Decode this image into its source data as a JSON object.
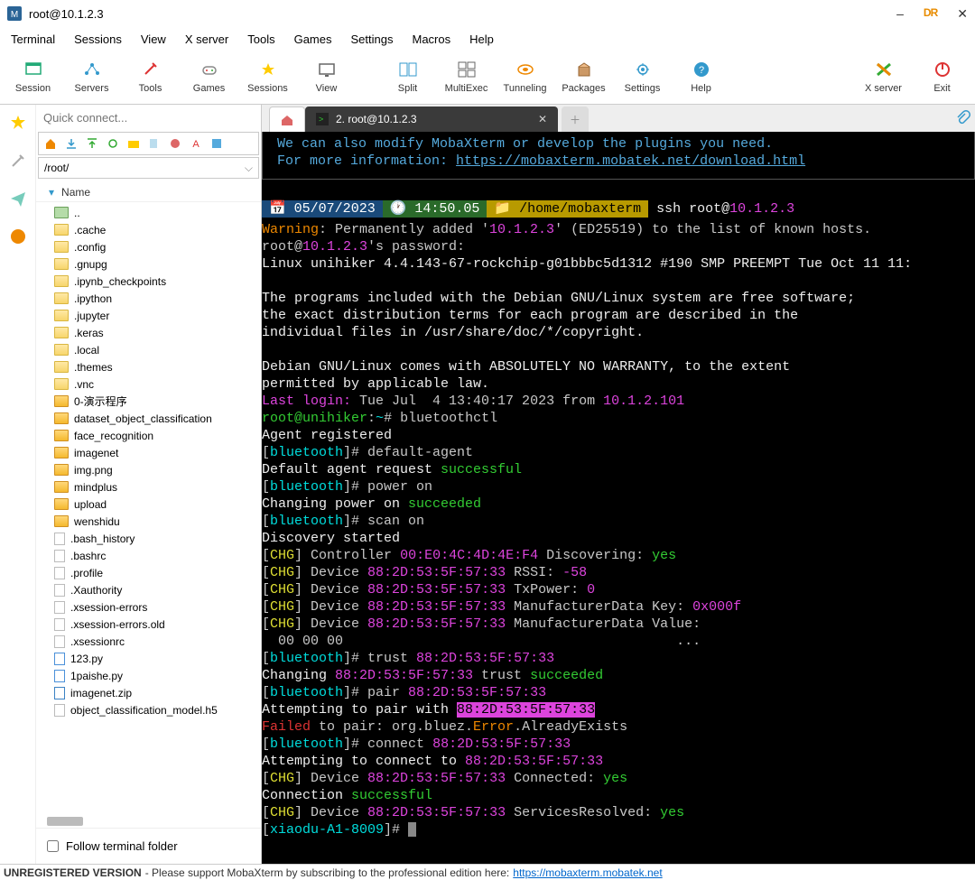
{
  "window": {
    "title": "root@10.1.2.3"
  },
  "menu": [
    "Terminal",
    "Sessions",
    "View",
    "X server",
    "Tools",
    "Games",
    "Settings",
    "Macros",
    "Help"
  ],
  "toolbar": {
    "items": [
      {
        "id": "session",
        "label": "Session"
      },
      {
        "id": "servers",
        "label": "Servers"
      },
      {
        "id": "tools",
        "label": "Tools"
      },
      {
        "id": "games",
        "label": "Games"
      },
      {
        "id": "sessions",
        "label": "Sessions"
      },
      {
        "id": "view",
        "label": "View"
      }
    ],
    "items2": [
      {
        "id": "split",
        "label": "Split"
      },
      {
        "id": "multiexec",
        "label": "MultiExec"
      },
      {
        "id": "tunneling",
        "label": "Tunneling"
      },
      {
        "id": "packages",
        "label": "Packages"
      },
      {
        "id": "settings",
        "label": "Settings"
      },
      {
        "id": "help",
        "label": "Help"
      }
    ],
    "right": [
      {
        "id": "xserver",
        "label": "X server"
      },
      {
        "id": "exit",
        "label": "Exit"
      }
    ]
  },
  "side": {
    "quick_placeholder": "Quick connect...",
    "path": "/root/",
    "name_header": "Name",
    "follow": "Follow terminal folder",
    "files": [
      {
        "n": "..",
        "t": "up"
      },
      {
        "n": ".cache",
        "t": "f"
      },
      {
        "n": ".config",
        "t": "f"
      },
      {
        "n": ".gnupg",
        "t": "f"
      },
      {
        "n": ".ipynb_checkpoints",
        "t": "f"
      },
      {
        "n": ".ipython",
        "t": "f"
      },
      {
        "n": ".jupyter",
        "t": "f"
      },
      {
        "n": ".keras",
        "t": "f"
      },
      {
        "n": ".local",
        "t": "f"
      },
      {
        "n": ".themes",
        "t": "f"
      },
      {
        "n": ".vnc",
        "t": "f"
      },
      {
        "n": "0-演示程序",
        "t": "fo"
      },
      {
        "n": "dataset_object_classification",
        "t": "fo"
      },
      {
        "n": "face_recognition",
        "t": "fo"
      },
      {
        "n": "imagenet",
        "t": "fo"
      },
      {
        "n": "img.png",
        "t": "fo"
      },
      {
        "n": "mindplus",
        "t": "fo"
      },
      {
        "n": "upload",
        "t": "fo"
      },
      {
        "n": "wenshidu",
        "t": "fo"
      },
      {
        "n": ".bash_history",
        "t": "file"
      },
      {
        "n": ".bashrc",
        "t": "file"
      },
      {
        "n": ".profile",
        "t": "file"
      },
      {
        "n": ".Xauthority",
        "t": "file"
      },
      {
        "n": ".xsession-errors",
        "t": "file"
      },
      {
        "n": ".xsession-errors.old",
        "t": "file"
      },
      {
        "n": ".xsessionrc",
        "t": "file"
      },
      {
        "n": "123.py",
        "t": "py"
      },
      {
        "n": "1paishe.py",
        "t": "py"
      },
      {
        "n": "imagenet.zip",
        "t": "zip"
      },
      {
        "n": "object_classification_model.h5",
        "t": "file"
      }
    ]
  },
  "tabs": {
    "active_label": "2. root@10.1.2.3"
  },
  "term": {
    "info1": "We can also modify MobaXterm or develop the plugins you need.",
    "info2a": "For more information: ",
    "info2b": "https://mobaxterm.mobatek.net/download.html",
    "date": "05/07/2023",
    "time": "14:50.05",
    "path": "/home/mobaxterm",
    "cmd0a": " ssh root@",
    "cmd0b": "10.1.2.3",
    "warn_a": "Warning",
    "warn_b": ": Permanently added '",
    "warn_c": "10.1.2.3",
    "warn_d": "' (ED25519) to the list of known hosts.",
    "pw_a": "root@",
    "pw_b": "10.1.2.3",
    "pw_c": "'s password:",
    "linux": "Linux unihiker 4.4.143-67-rockchip-g01bbbc5d1312 #190 SMP PREEMPT Tue Oct 11 11:",
    "deb1": "The programs included with the Debian GNU/Linux system are free software;",
    "deb2": "the exact distribution terms for each program are described in the",
    "deb3": "individual files in /usr/share/doc/*/copyright.",
    "deb4": "Debian GNU/Linux comes with ABSOLUTELY NO WARRANTY, to the extent",
    "deb5": "permitted by applicable law.",
    "ll_a": "Last login:",
    "ll_b": " Tue Jul  4 13:40:17 2023 from ",
    "ll_c": "10.1.2.101",
    "pr1_a": "root@unihiker",
    "pr1_b": ":",
    "pr1_c": "~",
    "pr1_d": "# bluetoothctl",
    "agent": "Agent registered",
    "bt": "bluetooth",
    "da": "# default-agent",
    "suc": "successful",
    "dar": "Default agent request ",
    "po": "# power on",
    "cpo": "Changing power on ",
    "succ": "succeeded",
    "so": "# scan on",
    "ds": "Discovery started",
    "chg": "CHG",
    "ctl": " Controller ",
    "mac_ctl": "00:E0:4C:4D:4E:F4",
    "disc": " Discovering: ",
    "yes": "yes",
    "dev": " Device ",
    "mac": "88:2D:53:5F:57:33",
    "rssi": " RSSI: ",
    "rssiv": "-58",
    "txp": " TxPower: ",
    "txpv": "0",
    "mdk": " ManufacturerData Key: ",
    "mdkv": "0x000f",
    "mdv": " ManufacturerData Value:",
    "hexrow": "  00 00 00                                         ...",
    "tr": "# trust ",
    "ch_a": "Changing ",
    "ch_b": " trust ",
    "pa": "# pair ",
    "apw": "Attempting to pair with ",
    "fail": "Failed",
    "fail_b": " to pair: org.bluez.",
    "err": "Error",
    "ae": ".AlreadyExists",
    "conn": "# connect ",
    "atc": "Attempting to connect to ",
    "connd": " Connected: ",
    "cs": "Connection ",
    "sr": " ServicesResolved: ",
    "pr2": "xiaodu-A1-8009",
    "hash": "# "
  },
  "footer": {
    "a": "UNREGISTERED VERSION",
    "b": "  -  Please support MobaXterm by subscribing to the professional edition here:  ",
    "c": "https://mobaxterm.mobatek.net"
  }
}
